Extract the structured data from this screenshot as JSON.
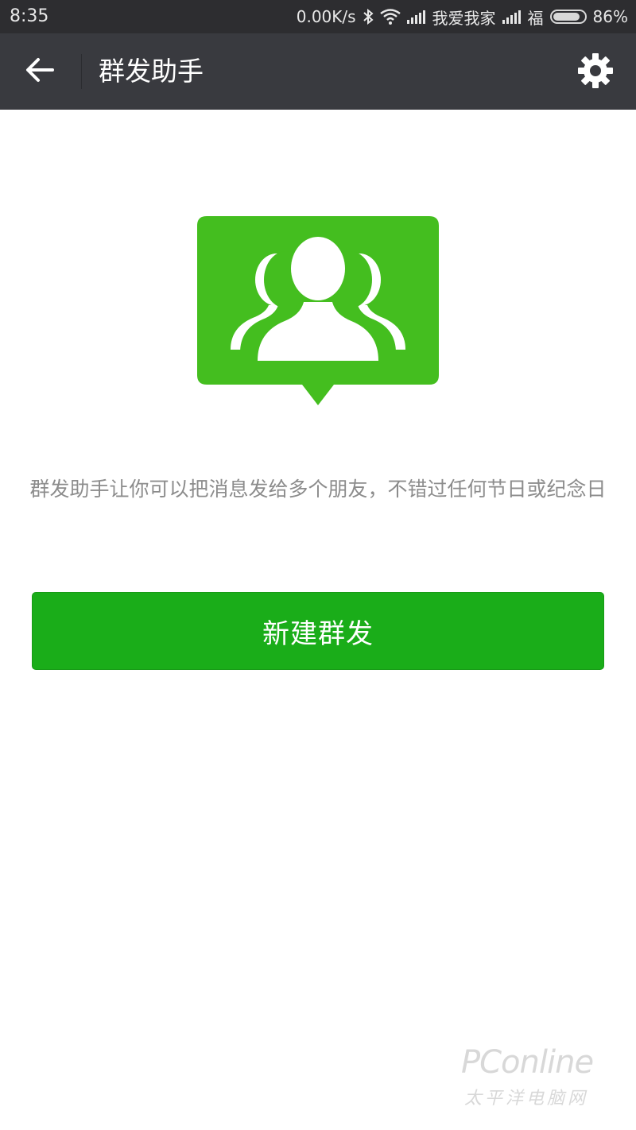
{
  "status_bar": {
    "time": "8:35",
    "network_speed": "0.00K/s",
    "carrier_1": "我爱我家",
    "carrier_2": "福",
    "battery": "86%",
    "battery_level": 0.86,
    "icons": [
      "bluetooth-icon",
      "wifi-icon",
      "signal-icon",
      "signal-icon",
      "battery-icon"
    ]
  },
  "action_bar": {
    "title": "群发助手",
    "back_icon": "arrow-left-icon",
    "settings_icon": "gear-icon"
  },
  "main": {
    "illustration_icon": "group-message-icon",
    "description": "群发助手让你可以把消息发给多个朋友，不错过任何节日或纪念日",
    "new_button_label": "新建群发"
  },
  "watermark": {
    "brand": "PConline",
    "subtitle": "太平洋电脑网"
  },
  "colors": {
    "accent_green": "#1aad19",
    "illustration_green": "#44be1f",
    "action_bar_bg": "#393a3f",
    "status_bar_bg": "#2d2d30"
  }
}
